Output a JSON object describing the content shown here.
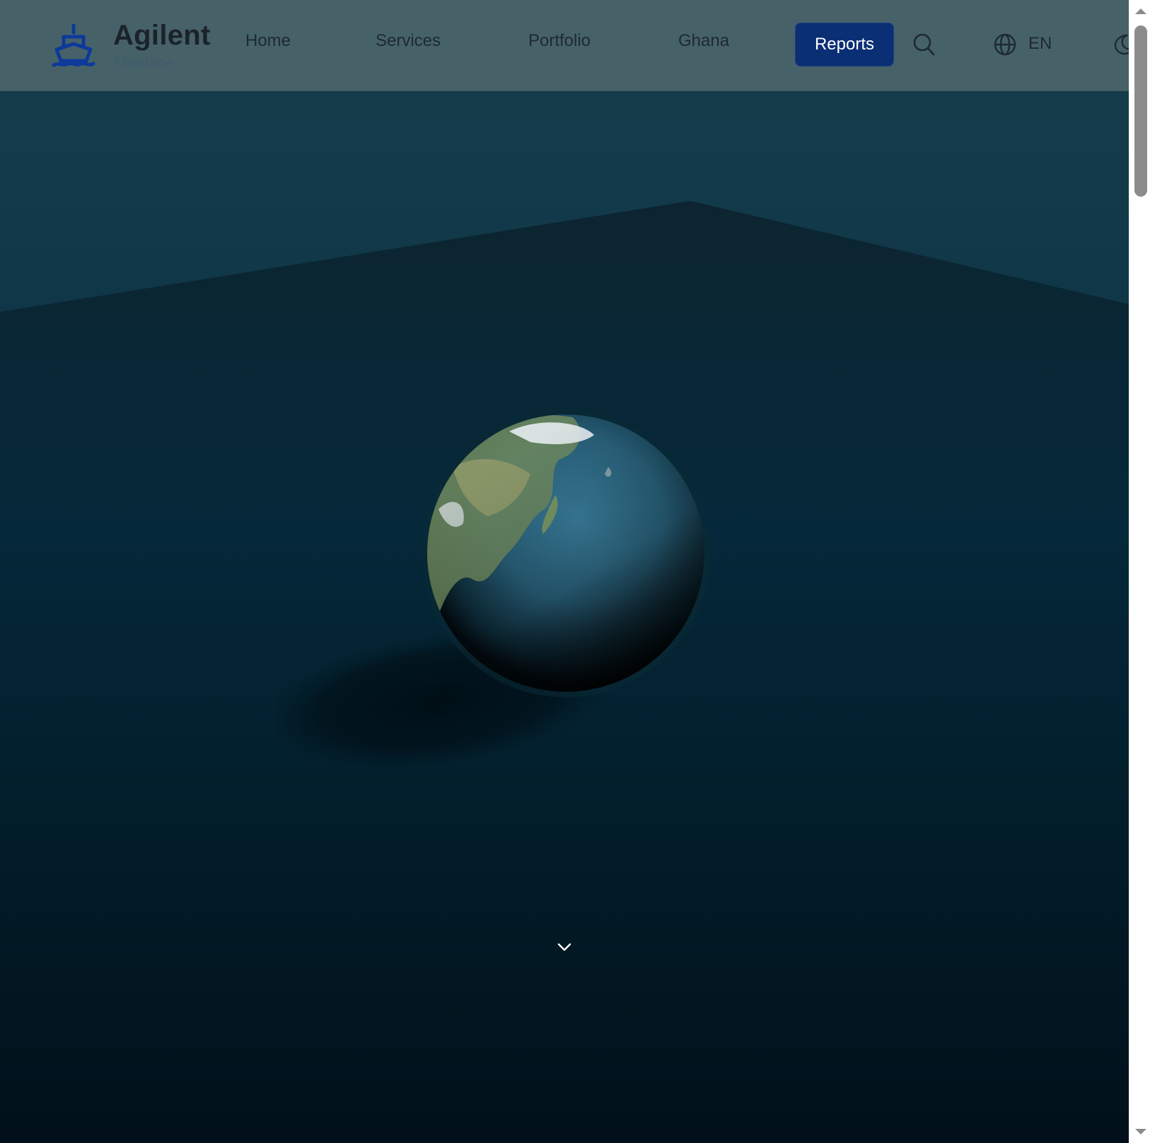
{
  "brand": {
    "name": "Agilent",
    "subtitle": "Maritime"
  },
  "nav": {
    "home": "Home",
    "services": "Services",
    "portfolio": "Portfolio",
    "ghana": "Ghana",
    "reports": "Reports"
  },
  "language": {
    "code": "EN"
  },
  "icons": {
    "logo": "ship-icon",
    "search": "search-icon",
    "language": "globe-icon",
    "theme": "moon-icon",
    "scroll": "chevron-down-icon"
  },
  "colors": {
    "header_bg": "#476169",
    "reports_button": "#0b2f75",
    "logo": "#0d3a9a",
    "hero_top": "#153e4c",
    "hero_bottom": "#01111a"
  }
}
